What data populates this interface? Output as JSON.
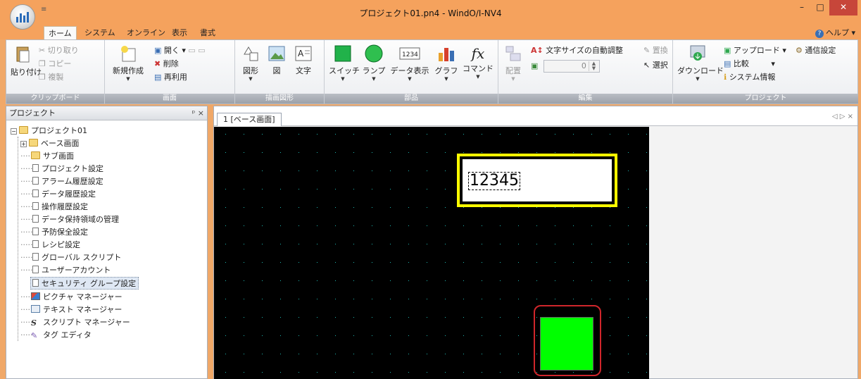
{
  "window": {
    "title": "プロジェクト01.pn4 - WindO/I-NV4",
    "qat_glyph": "≡",
    "min_glyph": "–",
    "max_glyph": "□",
    "close_glyph": "✕"
  },
  "ribbon_tabs": [
    "ホーム",
    "システム",
    "オンライン",
    "表示",
    "書式"
  ],
  "help_label": "ヘルプ",
  "ribbon": {
    "clipboard": {
      "paste": "貼り付け",
      "cut": "切り取り",
      "copy": "コピー",
      "duplicate": "複製",
      "label": "クリップボード"
    },
    "screen": {
      "new": "新規作成",
      "open": "開く",
      "delete": "削除",
      "reuse": "再利用",
      "label": "画面"
    },
    "drawing": {
      "shape": "図形",
      "figure": "図",
      "text": "文字",
      "label": "描画図形"
    },
    "parts": {
      "switch": "スイッチ",
      "lamp": "ランプ",
      "data_display": "データ表示",
      "graph": "グラフ",
      "command": "コマンド",
      "data_icon_text": "1234",
      "fx_text": "fx",
      "label": "部品"
    },
    "edit": {
      "arrange": "配置",
      "auto_font": "文字サイズの自動調整",
      "replace": "置換",
      "select": "選択",
      "spin_value": "0",
      "label": "編集"
    },
    "project": {
      "download": "ダウンロード",
      "upload": "アップロード",
      "compare": "比較",
      "sysinfo": "システム情報",
      "comm": "通信設定",
      "label": "プロジェクト"
    }
  },
  "project_pane": {
    "title": "プロジェクト",
    "controls": "ᵖ ×",
    "root": "プロジェクト01",
    "items": [
      {
        "label": "ベース画面",
        "type": "folder",
        "expandable": true
      },
      {
        "label": "サブ画面",
        "type": "folder",
        "expandable": false
      },
      {
        "label": "プロジェクト設定",
        "type": "doc"
      },
      {
        "label": "アラーム履歴設定",
        "type": "doc"
      },
      {
        "label": "データ履歴設定",
        "type": "doc"
      },
      {
        "label": "操作履歴設定",
        "type": "doc"
      },
      {
        "label": "データ保持領域の管理",
        "type": "doc"
      },
      {
        "label": "予防保全設定",
        "type": "doc"
      },
      {
        "label": "レシピ設定",
        "type": "doc"
      },
      {
        "label": "グローバル スクリプト",
        "type": "doc"
      },
      {
        "label": "ユーザーアカウント",
        "type": "doc"
      },
      {
        "label": "セキュリティ グループ設定",
        "type": "doc",
        "selected": true
      },
      {
        "label": "ピクチャ マネージャー",
        "type": "picture"
      },
      {
        "label": "テキスト マネージャー",
        "type": "text"
      },
      {
        "label": "スクリプト マネージャー",
        "type": "script"
      },
      {
        "label": "タグ エディタ",
        "type": "tag"
      }
    ]
  },
  "document": {
    "tab_label": "1 [ベース画面]",
    "tab_controls": "◁ ▷ ×",
    "data_display_value": "12345",
    "lamp_color": "#00ff00",
    "highlight_color": "#d0262b",
    "display_border_color": "#ffff00"
  }
}
